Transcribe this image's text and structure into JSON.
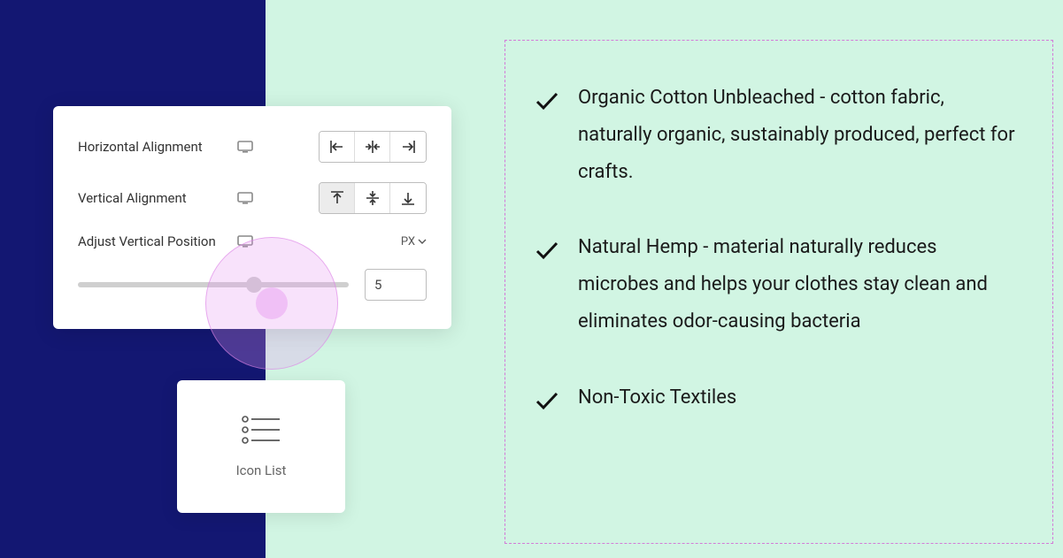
{
  "panel": {
    "horizontal": {
      "label": "Horizontal Alignment",
      "active_index": -1
    },
    "vertical": {
      "label": "Vertical Alignment",
      "active_index": 0
    },
    "adjust": {
      "label": "Adjust Vertical Position",
      "unit": "PX",
      "value": "5"
    }
  },
  "widget": {
    "label": "Icon List"
  },
  "list": {
    "items": [
      "Organic Cotton Unbleached - cotton fabric, naturally organic, sustainably produced, perfect for crafts.",
      "Natural Hemp - material naturally reduces microbes and helps your clothes stay clean and eliminates odor-causing bacteria",
      "Non-Toxic Textiles"
    ]
  }
}
